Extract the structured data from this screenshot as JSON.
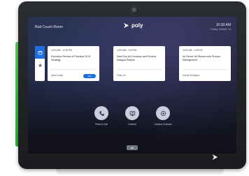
{
  "device": {
    "room_name": "Red Couch Room",
    "brand": "poly",
    "time": "10:30 AM",
    "date": "Friday, October 14"
  },
  "sidebar": {
    "tabs": [
      {
        "icon": "calendar-icon",
        "active": true
      },
      {
        "icon": "star-icon",
        "active": false
      }
    ]
  },
  "meetings": [
    {
      "time": "10:00 AM - 12:00 PM",
      "title": "Executive Review of Practical 2015 Strategy",
      "organizer": "Isabel Gaba",
      "join": "Join"
    },
    {
      "time": "12:00 AM - 1:00 PM",
      "title": "Next Run All Concepts and Product Designs Review",
      "organizer": "Pablo Ou"
    },
    {
      "time": "12:00 AM - 1:00 PM",
      "title": "Its Friend: All Review with Product Management",
      "organizer": "Haruki Rodriguez"
    }
  ],
  "actions": [
    {
      "icon": "phone-icon",
      "label": "Place A Call"
    },
    {
      "icon": "screen-share-icon",
      "label": "Content"
    },
    {
      "icon": "add-contacts-icon",
      "label": "Camera Controls"
    }
  ],
  "colors": {
    "accent": "#1f6fe0",
    "green_edge": "#3fbf3a"
  }
}
